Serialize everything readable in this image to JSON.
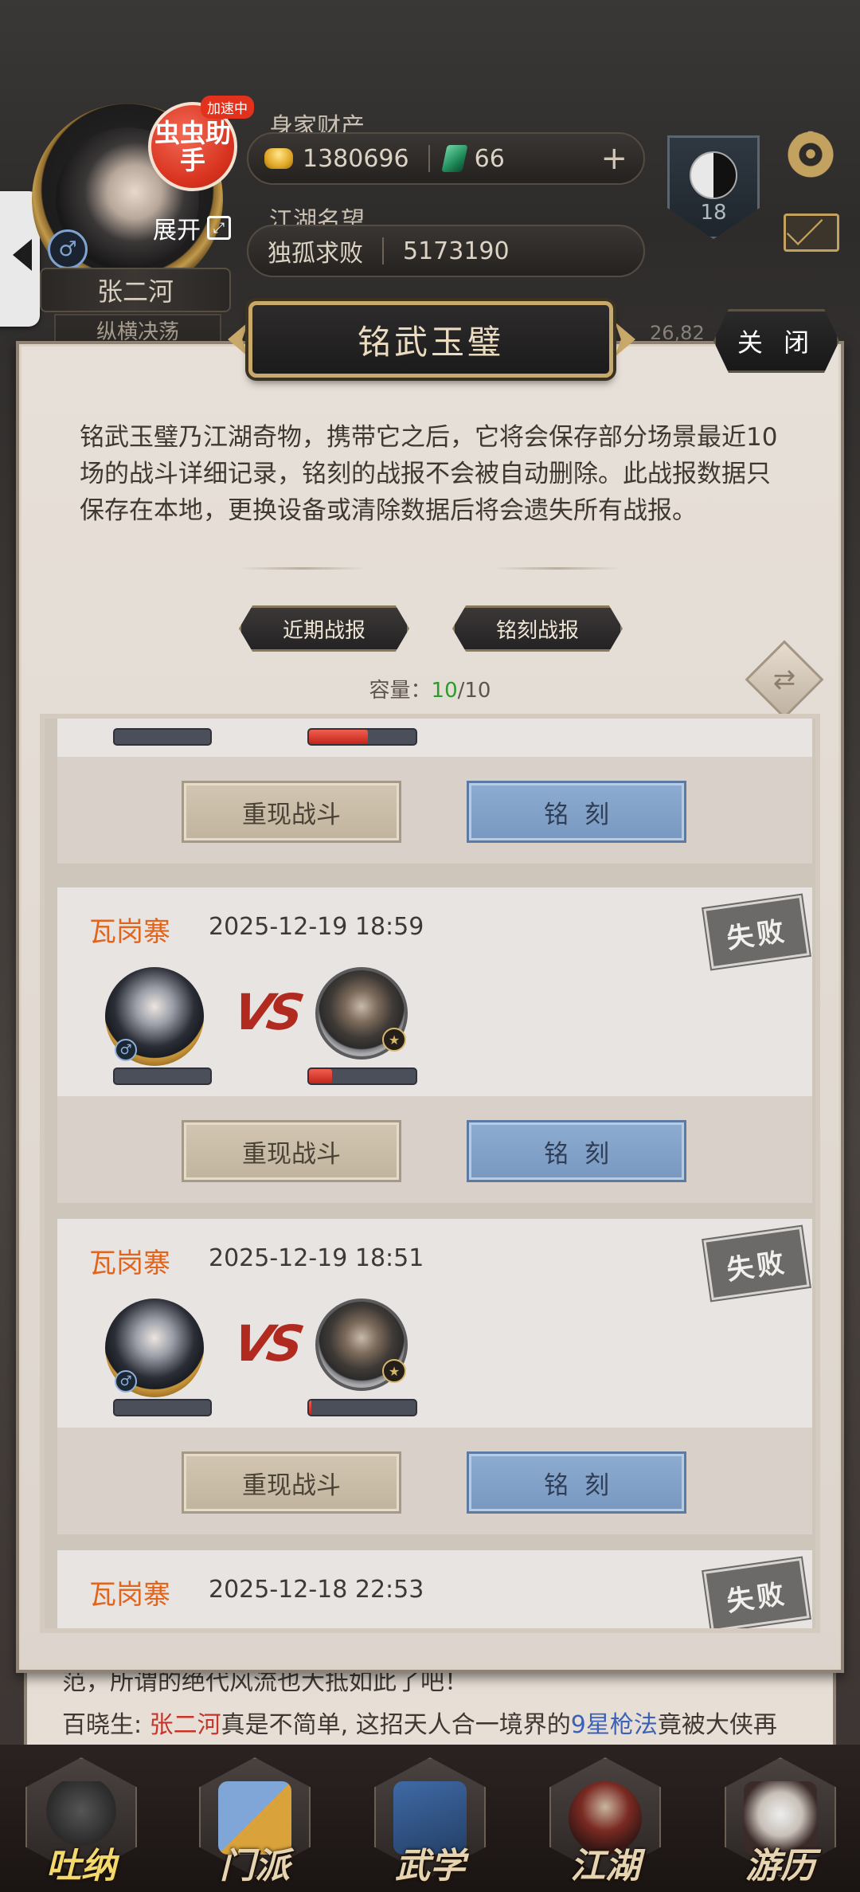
{
  "header": {
    "helper_badge": "虫虫助手",
    "speed_tag": "加速中",
    "expand_label": "展开",
    "expand_icon": "expand-icon",
    "player_name": "张二河",
    "player_title": "纵横决荡",
    "wealth_label": "身家财产",
    "gold_amount": "1380696",
    "jade_amount": "66",
    "plus_symbol": "+",
    "fame_label": "江湖名望",
    "fame_title": "独孤求败",
    "fame_amount": "5173190",
    "rank_level": "18",
    "gender_symbol": "♂",
    "peek_number": "26,82",
    "gear_glyph": "⚙"
  },
  "modal": {
    "title": "铭武玉璧",
    "close_label": "关 闭",
    "description": "铭武玉璧乃江湖奇物，携带它之后，它将会保存部分场景最近10场的战斗详细记录，铭刻的战报不会被自动删除。此战报数据只保存在本地，更换设备或清除数据后将会遗失所有战报。",
    "tab_recent": "近期战报",
    "tab_engraved": "铭刻战报",
    "capacity_label": "容量：",
    "capacity_current": "10",
    "capacity_max": "/10",
    "swap_glyph": "⇄"
  },
  "battles": [
    {
      "location": "",
      "datetime": "",
      "result": "",
      "enemy_hp": 0.55,
      "replay_label": "重现战斗",
      "engrave_label": "铭刻"
    },
    {
      "location": "瓦岗寨",
      "datetime": "2025-12-19 18:59",
      "result": "失败",
      "enemy_hp": 0.22,
      "replay_label": "重现战斗",
      "engrave_label": "铭刻"
    },
    {
      "location": "瓦岗寨",
      "datetime": "2025-12-19 18:51",
      "result": "失败",
      "enemy_hp": 0.02,
      "replay_label": "重现战斗",
      "engrave_label": "铭刻"
    },
    {
      "location": "瓦岗寨",
      "datetime": "2025-12-18 22:53",
      "result": "失败"
    }
  ],
  "vs_text": "VS",
  "chat": {
    "line1": "范，所谓的绝代风流也大抵如此了吧！",
    "line2_prefix": "百晓生: ",
    "line2_name": "张二河",
    "line2_mid": "真是不简单, 这招天人合一境界的",
    "line2_skill": "9星枪法",
    "line2_suffix": "竟被大侠再"
  },
  "nav": [
    {
      "label": "吐纳",
      "icon": "breathing-icon",
      "active": true
    },
    {
      "label": "门派",
      "icon": "sect-icon"
    },
    {
      "label": "武学",
      "icon": "martial-arts-icon"
    },
    {
      "label": "江湖",
      "icon": "jianghu-icon"
    },
    {
      "label": "游历",
      "icon": "travel-icon"
    }
  ],
  "colors": {
    "accent_orange": "#e0661f",
    "capacity_green": "#2e9a2e",
    "engrave_blue": "#8eacd1",
    "hp_red": "#c22519"
  }
}
